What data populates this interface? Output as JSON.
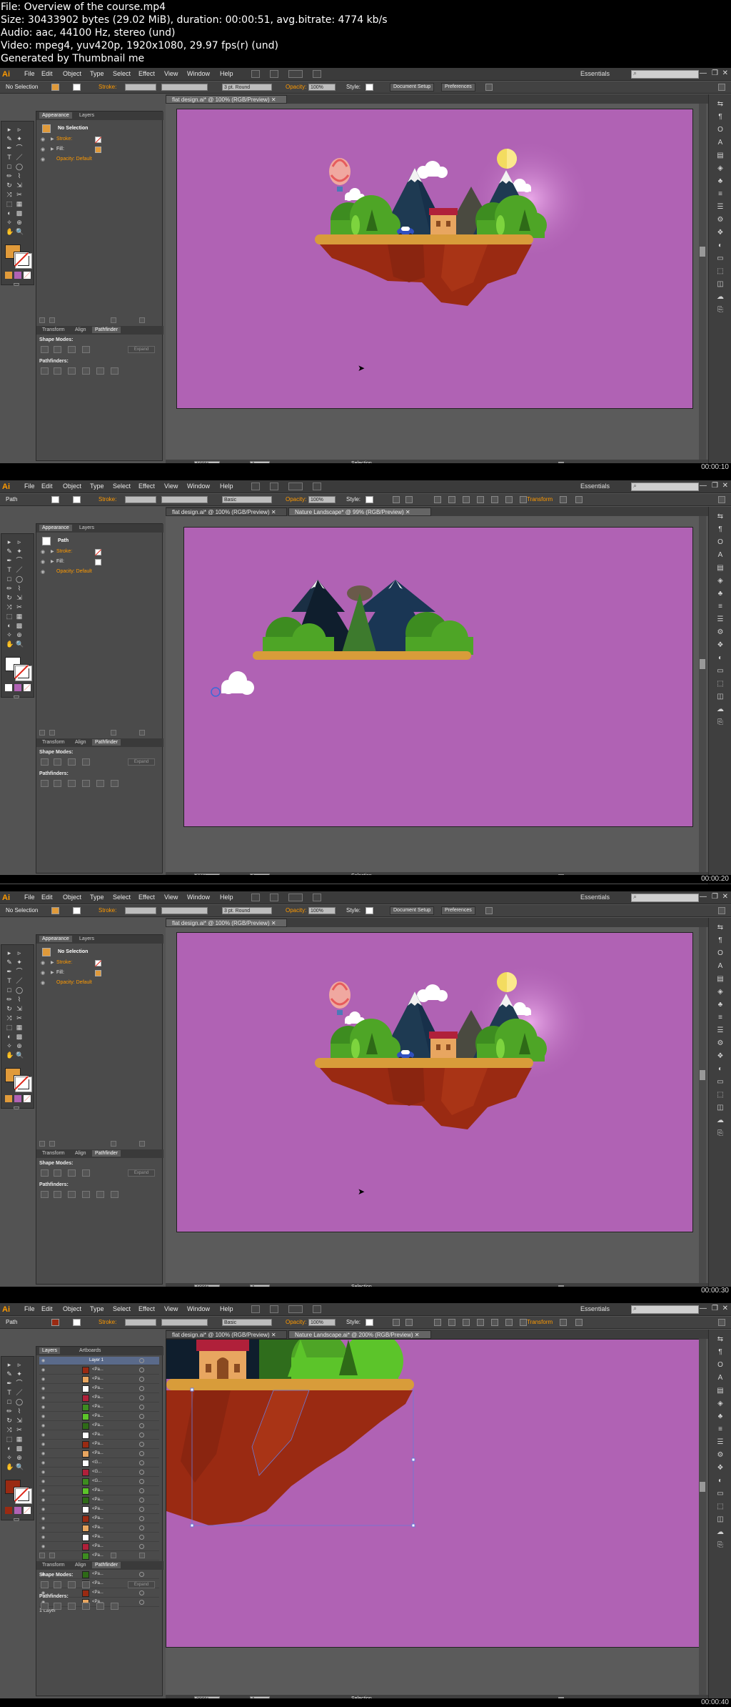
{
  "header": {
    "lines": [
      "File: Overview of the course.mp4",
      "Size: 30433902 bytes (29.02 MiB), duration: 00:00:51, avg.bitrate: 4774 kb/s",
      "Audio: aac, 44100 Hz, stereo (und)",
      "Video: mpeg4, yuv420p, 1920x1080, 29.97 fps(r) (und)",
      "Generated by Thumbnail me"
    ]
  },
  "menubar": {
    "logo": "Ai",
    "items": [
      "File",
      "Edit",
      "Object",
      "Type",
      "Select",
      "Effect",
      "View",
      "Window",
      "Help"
    ],
    "workspace": "Essentials",
    "window_controls": [
      "—",
      "❐",
      "✕"
    ]
  },
  "icons": {
    "eye": "eye-icon",
    "arrow": "disclosure-triangle-icon",
    "search": "search-icon"
  },
  "colors": {
    "artboard": "#b062b4",
    "fill_orange": "#e09a3a",
    "fill_white": "#ffffff",
    "fill_red": "#9a2a12",
    "ui_accent": "#ff9a00"
  },
  "frames": [
    {
      "timestamp": "00:00:10",
      "ctrl": {
        "selection": "No Selection",
        "stroke": "Stroke:",
        "brush": "3 pt. Round",
        "opacity": "Opacity:",
        "opacity_val": "100%",
        "style": "Style:",
        "doc_setup": "Document Setup",
        "prefs": "Preferences"
      },
      "tabs": [
        {
          "label": "flat design.ai* @ 100% (RGB/Preview)"
        }
      ],
      "panel": {
        "tabs": [
          "Appearance",
          "Layers"
        ],
        "title": "No Selection",
        "rows": [
          "Stroke:",
          "Fill:",
          "Opacity: Default"
        ]
      },
      "bottom": {
        "tabs": [
          "Transform",
          "Align",
          "Pathfinder"
        ],
        "shape_modes": "Shape Modes:",
        "pathfinders": "Pathfinders:",
        "expand": "Expand"
      },
      "status": {
        "zoom": "100%",
        "page": "1",
        "mode": "Selection"
      }
    },
    {
      "timestamp": "00:00:20",
      "ctrl": {
        "selection": "Path",
        "stroke": "Stroke:",
        "brush": "Basic",
        "opacity": "Opacity:",
        "opacity_val": "100%",
        "style": "Style:",
        "transform": "Transform"
      },
      "tabs": [
        {
          "label": "flat design.ai* @ 100% (RGB/Preview)"
        },
        {
          "label": "Nature Landscape* @ 99% (RGB/Preview)"
        }
      ],
      "panel": {
        "tabs": [
          "Appearance",
          "Layers"
        ],
        "title": "Path",
        "rows": [
          "Stroke:",
          "Fill:",
          "Opacity: Default"
        ]
      },
      "bottom": {
        "tabs": [
          "Transform",
          "Align",
          "Pathfinder"
        ],
        "shape_modes": "Shape Modes:",
        "pathfinders": "Pathfinders:",
        "expand": "Expand"
      },
      "status": {
        "zoom": "99%",
        "page": "1",
        "mode": "Selection"
      }
    },
    {
      "timestamp": "00:00:30",
      "ctrl": {
        "selection": "No Selection",
        "stroke": "Stroke:",
        "brush": "3 pt. Round",
        "opacity": "Opacity:",
        "opacity_val": "100%",
        "style": "Style:",
        "doc_setup": "Document Setup",
        "prefs": "Preferences"
      },
      "tabs": [
        {
          "label": "flat design.ai* @ 100% (RGB/Preview)"
        }
      ],
      "panel": {
        "tabs": [
          "Appearance",
          "Layers"
        ],
        "title": "No Selection",
        "rows": [
          "Stroke:",
          "Fill:",
          "Opacity: Default"
        ]
      },
      "bottom": {
        "tabs": [
          "Transform",
          "Align",
          "Pathfinder"
        ],
        "shape_modes": "Shape Modes:",
        "pathfinders": "Pathfinders:",
        "expand": "Expand"
      },
      "status": {
        "zoom": "100%",
        "page": "1",
        "mode": "Selection"
      }
    },
    {
      "timestamp": "00:00:40",
      "ctrl": {
        "selection": "Path",
        "stroke": "Stroke:",
        "brush": "Basic",
        "opacity": "Opacity:",
        "opacity_val": "100%",
        "style": "Style:",
        "transform": "Transform"
      },
      "tabs": [
        {
          "label": "flat design.ai* @ 100% (RGB/Preview)"
        },
        {
          "label": "Nature Landscape.ai* @ 200% (RGB/Preview)"
        }
      ],
      "panel": {
        "tabs": [
          "Layers",
          "Artboards"
        ],
        "title": "Layer 1",
        "layer_count": "1 Layer",
        "rows": [
          "<Pa...",
          "<Pa...",
          "<Pa...",
          "<Pa...",
          "<Pa...",
          "<Pa...",
          "<Pa...",
          "<Pa...",
          "<Pa...",
          "<Pa...",
          "<G...",
          "<G...",
          "<G...",
          "<Pa...",
          "<Pa...",
          "<Pa...",
          "<Pa...",
          "<Pa...",
          "<Pa...",
          "<Pa...",
          "<Pa...",
          "<Pa...",
          "<Pa...",
          "<Pa...",
          "<Pa...",
          "<Pa..."
        ]
      },
      "bottom": {
        "tabs": [
          "Transform",
          "Align",
          "Pathfinder"
        ],
        "shape_modes": "Shape Modes:",
        "pathfinders": "Pathfinders:",
        "expand": "Expand"
      },
      "status": {
        "zoom": "200%",
        "page": "1",
        "mode": "Selection"
      }
    }
  ]
}
